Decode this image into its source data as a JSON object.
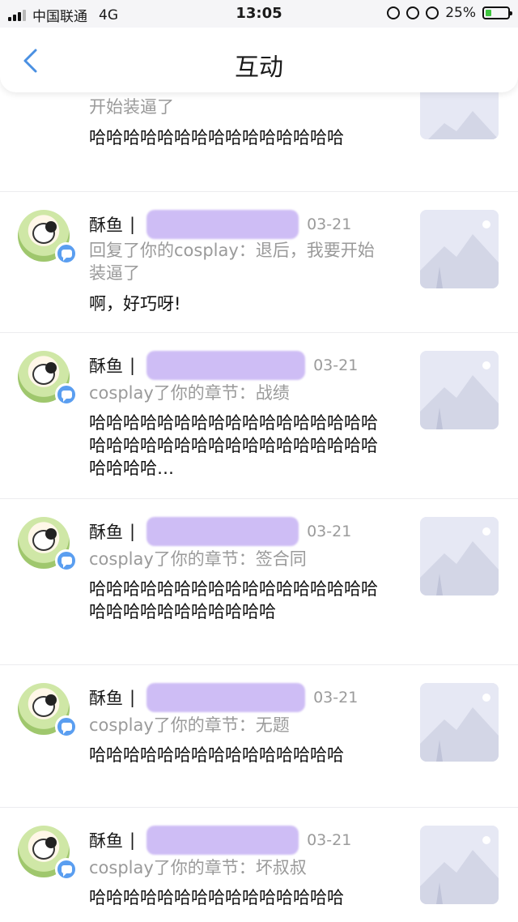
{
  "status": {
    "carrier": "中国联通",
    "network": "4G",
    "time": "13:05",
    "battery": "25%"
  },
  "nav": {
    "title": "互动",
    "back_icon": "chevron-left-icon"
  },
  "items": [
    {
      "action_partial": "开始装逼了",
      "comment": "哈哈哈哈哈哈哈哈哈哈哈哈哈哈哈"
    },
    {
      "user": "酥鱼",
      "sep": "|",
      "date": "03-21",
      "action": "回复了你的cosplay：退后，我要开始装逼了",
      "comment": "啊，好巧呀!"
    },
    {
      "user": "酥鱼",
      "sep": "|",
      "date": "03-21",
      "action": "cosplay了你的章节：战绩",
      "comment": "哈哈哈哈哈哈哈哈哈哈哈哈哈哈哈哈哈哈哈哈哈哈哈哈哈哈哈哈哈哈哈哈哈哈哈哈哈哈…"
    },
    {
      "user": "酥鱼",
      "sep": "|",
      "date": "03-21",
      "action": "cosplay了你的章节：签合同",
      "comment": "哈哈哈哈哈哈哈哈哈哈哈哈哈哈哈哈哈哈哈哈哈哈哈哈哈哈哈哈"
    },
    {
      "user": "酥鱼",
      "sep": "|",
      "date": "03-21",
      "action": "cosplay了你的章节：无题",
      "comment": "哈哈哈哈哈哈哈哈哈哈哈哈哈哈哈"
    },
    {
      "user": "酥鱼",
      "sep": "|",
      "date": "03-21",
      "action": "cosplay了你的章节：坏叔叔",
      "comment": "哈哈哈哈哈哈哈哈哈哈哈哈哈哈哈"
    }
  ],
  "colors": {
    "accent": "#5a9ef0",
    "redaction": "#c9b6f4",
    "secondary_text": "#9a9a9a"
  }
}
